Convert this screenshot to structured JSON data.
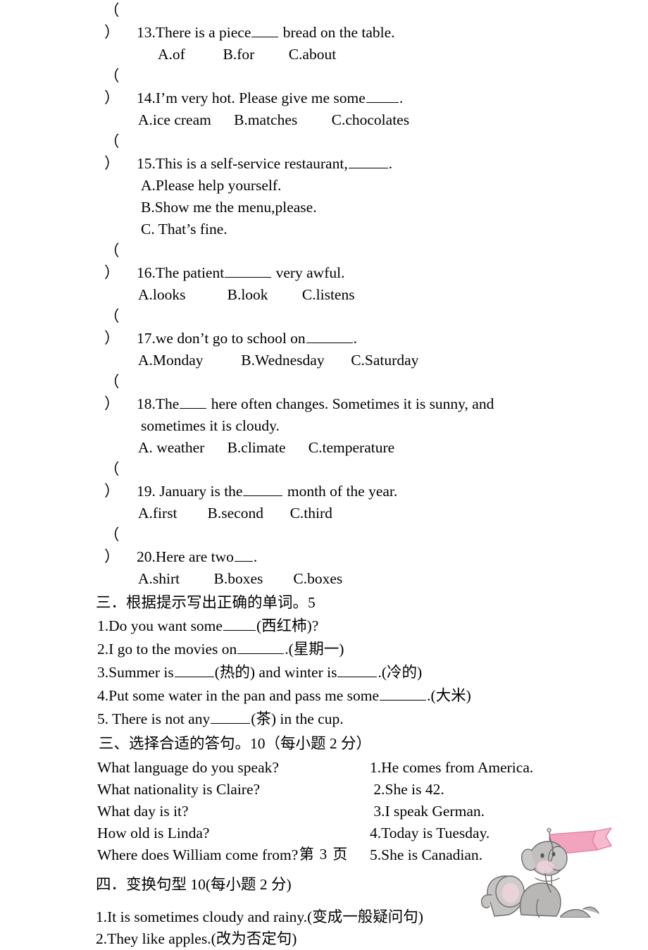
{
  "page": {
    "footer_prefix": "第",
    "page_number": "3",
    "footer_suffix": "页",
    "background": "#ffffff",
    "text_color": "#000000"
  },
  "multiple_choice": {
    "questions": [
      {
        "paren": "（      ）",
        "number": "13.",
        "stem_before": "There is a piece",
        "blank": "b4",
        "stem_after": " bread on the table.",
        "options_line": "A.of          B.for         C.about"
      },
      {
        "paren": "（      ）",
        "number": "14.",
        "stem_before": "I’m very hot. Please give me some",
        "blank": "b5",
        "stem_after": ".",
        "options_line": "A.ice cream      B.matches         C.chocolates"
      },
      {
        "paren": "（      ）",
        "number": "15.",
        "stem_before": "This is a self-service restaurant,",
        "blank": "b6",
        "stem_after": ".",
        "options_stacked": [
          "A.Please help yourself.",
          "B.Show me the menu,please.",
          "C. That’s fine."
        ]
      },
      {
        "paren": "（      ）",
        "number": "16.",
        "stem_before": "The patient",
        "blank": "b7",
        "stem_after": " very awful.",
        "options_line": "A.looks           B.look         C.listens"
      },
      {
        "paren": "（      ）",
        "number": "17.",
        "stem_before": "we don’t go to school on",
        "blank": "b7",
        "stem_after": ".",
        "options_line": "A.Monday          B.Wednesday       C.Saturday"
      },
      {
        "paren": "（      ）",
        "number": "18.",
        "stem_before": "The",
        "blank": "b4",
        "stem_after": " here often changes. Sometimes it is sunny, and",
        "continuation": "sometimes it is cloudy.",
        "options_line": "A. weather      B.climate      C.temperature",
        "justified": true
      },
      {
        "paren": "（      ）",
        "number": "19.",
        "stem_before": " January is the",
        "blank": "b6",
        "stem_after": " month of the year.",
        "options_line": "A.first        B.second       C.third"
      },
      {
        "paren": "（      ）",
        "number": "20.",
        "stem_before": "Here are two",
        "blank": "b3",
        "stem_after": ".",
        "options_line": "A.shirt         B.boxes        C.boxes"
      }
    ]
  },
  "section_three_words": {
    "heading": "三．根据提示写出正确的单词。5",
    "items": [
      {
        "prefix": "1.Do you want some",
        "blank": "b5",
        "suffix": "(西红柿)?"
      },
      {
        "prefix": "2.I go to the movies on",
        "blank": "b7",
        "suffix": ".(星期一)"
      },
      {
        "prefix": "3.Summer is",
        "blank": "b6",
        "mid": "(热的) and winter is",
        "blank2": "b6",
        "suffix": ".(冷的)"
      },
      {
        "prefix": "4.Put some water in the pan and pass me some",
        "blank": "b7",
        "suffix": ".(大米)"
      },
      {
        "prefix": "5. There is not any",
        "blank": "b6",
        "suffix": "(茶) in the cup."
      }
    ]
  },
  "section_matching": {
    "heading": "三、选择合适的答句。10（每小题 2 分）",
    "rows": [
      {
        "question": "What language do you speak?",
        "answer": "1.He comes from America."
      },
      {
        "question": "What nationality is Claire?",
        "answer": " 2.She is 42."
      },
      {
        "question": "What day is it?",
        "answer": " 3.I speak German."
      },
      {
        "question": "How old is Linda?",
        "answer": "4.Today is Tuesday."
      },
      {
        "question": "Where does William come from?",
        "answer": "5.She is Canadian."
      }
    ]
  },
  "section_transform": {
    "heading": "四．变换句型 10(每小题 2 分)",
    "items": [
      "1.It is sometimes cloudy and rainy.(变成一般疑问句)",
      "2.They like apples.(改为否定句)"
    ]
  },
  "decoration": {
    "name": "two-elephants-with-pink-banner",
    "banner_color": "#f2a3bd",
    "banner_outline": "#e27d9e",
    "body_color": "#b9b6b6",
    "body_outline": "#6f6c6c",
    "blush_color": "#f3d3dc"
  }
}
